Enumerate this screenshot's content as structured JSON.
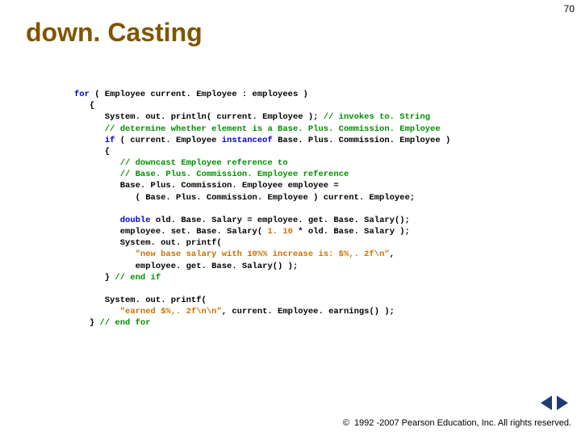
{
  "page_number": "70",
  "title": "down. Casting",
  "code": {
    "l1a": "for",
    "l1b": " ( Employee current. Employee : employees )",
    "l2": "   {",
    "l3a": "      System. out. println( current. Employee ); ",
    "l3b": "// invokes to. String",
    "l4": "      // determine whether element is a Base. Plus. Commission. Employee",
    "l5a": "      ",
    "l5b": "if",
    "l5c": " ( current. Employee ",
    "l5d": "instanceof",
    "l5e": " Base. Plus. Commission. Employee )",
    "l6": "      {",
    "l7": "         // downcast Employee reference to",
    "l8": "         // Base. Plus. Commission. Employee reference",
    "l9": "         Base. Plus. Commission. Employee employee =",
    "l10": "            ( Base. Plus. Commission. Employee ) current. Employee;",
    "blank1": " ",
    "l11a": "         ",
    "l11b": "double",
    "l11c": " old. Base. Salary = employee. get. Base. Salary();",
    "l12a": "         employee. set. Base. Salary( ",
    "l12b": "1. 10",
    "l12c": " * old. Base. Salary );",
    "l13": "         System. out. printf(",
    "l14a": "            ",
    "l14b": "\"new base salary with 10%% increase is: $%,. 2f\\n\"",
    "l14c": ",",
    "l15": "            employee. get. Base. Salary() );",
    "l16a": "      } ",
    "l16b": "// end if",
    "blank2": " ",
    "l17": "      System. out. printf(",
    "l18a": "         ",
    "l18b": "\"earned $%,. 2f\\n\\n\"",
    "l18c": ", current. Employee. earnings() );",
    "l19a": "   } ",
    "l19b": "// end for"
  },
  "footer": {
    "symbol": "©",
    "text": "1992 -2007 Pearson Education, Inc. All rights reserved."
  }
}
